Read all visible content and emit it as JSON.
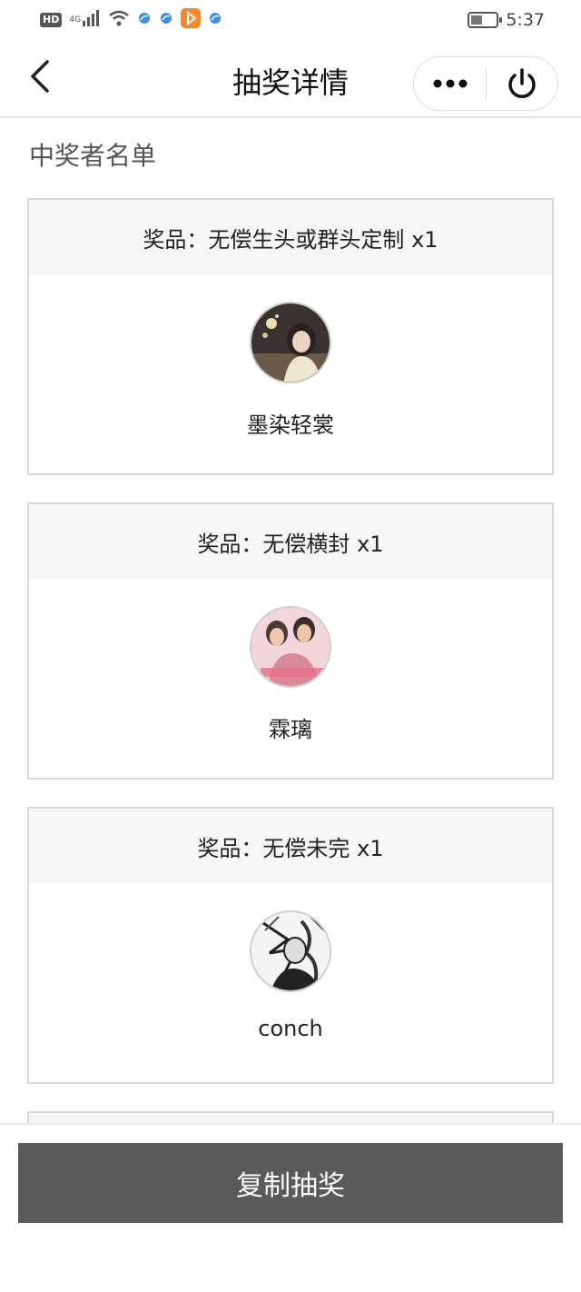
{
  "status_bar": {
    "network_label": "HD",
    "network_type": "4G",
    "time": "5:37",
    "battery_level": 0.45,
    "colors": {
      "orange_app": "#f08a2c",
      "blue_app": "#3f8de4"
    }
  },
  "nav": {
    "title": "抽奖详情",
    "back_icon": "chevron-left-icon",
    "more_icon": "more-dots-icon",
    "power_icon": "power-icon"
  },
  "section_title": "中奖者名单",
  "prizes": [
    {
      "label": "奖品：无偿生头或群头定制 x1",
      "winner": "墨染轻裳",
      "avatar_icon": "avatar-photo"
    },
    {
      "label": "奖品：无偿横封 x1",
      "winner": "霖璃",
      "avatar_icon": "avatar-photo"
    },
    {
      "label": "奖品：无偿未完 x1",
      "winner": "conch",
      "avatar_icon": "avatar-photo"
    }
  ],
  "bottom": {
    "copy_button_label": "复制抽奖",
    "button_color": "#5a5a5a"
  }
}
